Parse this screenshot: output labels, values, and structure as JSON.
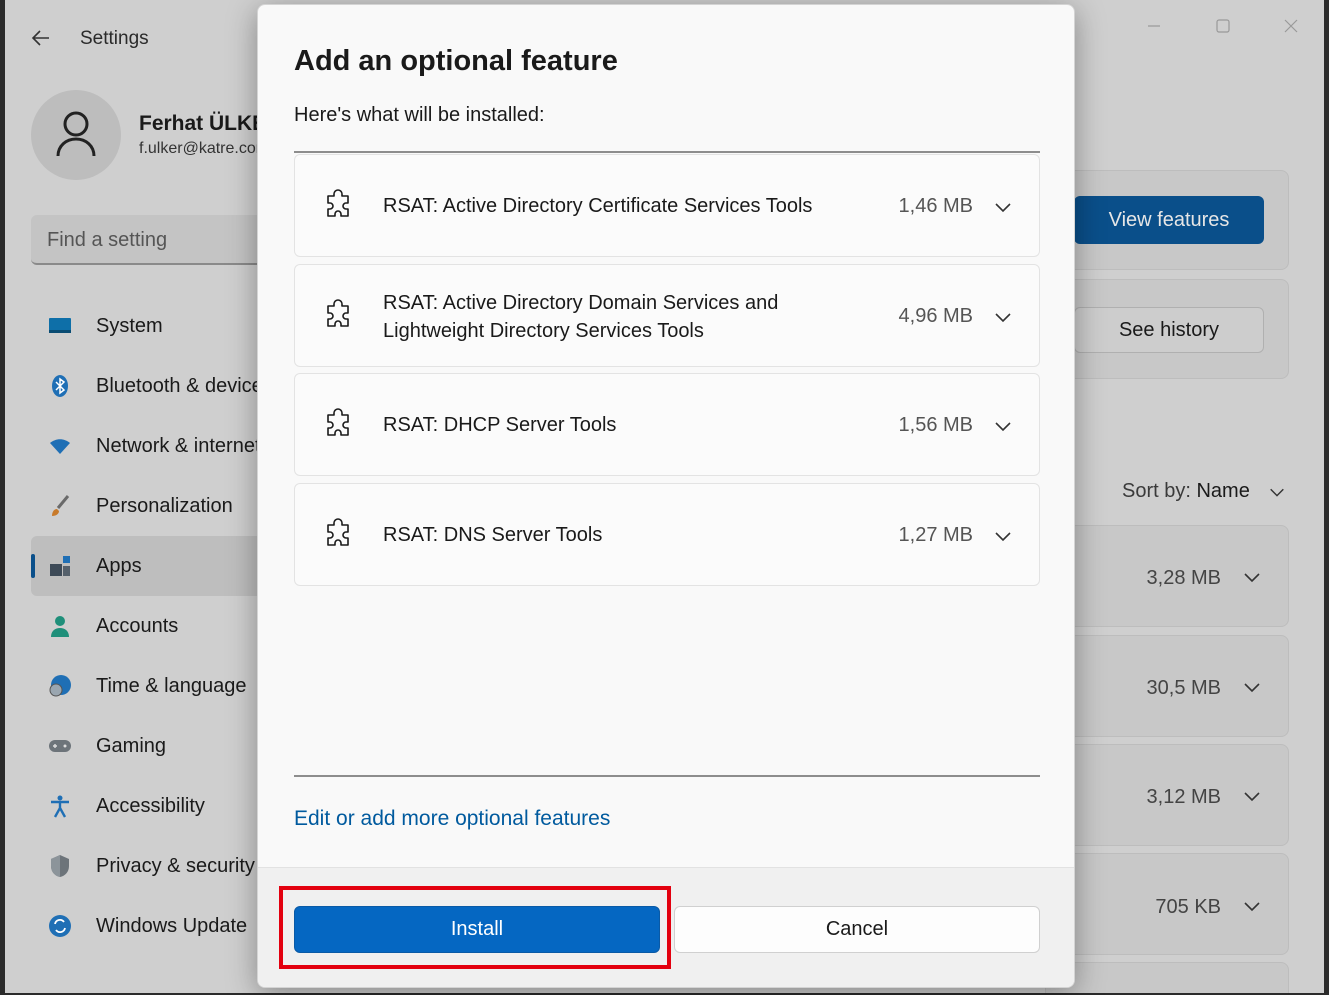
{
  "window": {
    "title": "Settings",
    "profile": {
      "name": "Ferhat ÜLKER",
      "email": "f.ulker@katre.com"
    },
    "search": {
      "placeholder": "Find a setting"
    },
    "nav": [
      {
        "label": "System",
        "icon": "monitor-icon",
        "active": false
      },
      {
        "label": "Bluetooth & devices",
        "icon": "bluetooth-icon",
        "active": false
      },
      {
        "label": "Network & internet",
        "icon": "wifi-icon",
        "active": false
      },
      {
        "label": "Personalization",
        "icon": "brush-icon",
        "active": false
      },
      {
        "label": "Apps",
        "icon": "apps-icon",
        "active": true
      },
      {
        "label": "Accounts",
        "icon": "person-icon",
        "active": false
      },
      {
        "label": "Time & language",
        "icon": "globe-clock-icon",
        "active": false
      },
      {
        "label": "Gaming",
        "icon": "gamepad-icon",
        "active": false
      },
      {
        "label": "Accessibility",
        "icon": "accessibility-icon",
        "active": false
      },
      {
        "label": "Privacy & security",
        "icon": "shield-icon",
        "active": false
      },
      {
        "label": "Windows Update",
        "icon": "update-icon",
        "active": false
      }
    ],
    "right": {
      "view_features_label": "View features",
      "see_history_label": "See history",
      "sort_label": "Sort by:",
      "sort_value": "Name",
      "installed_sizes": [
        "3,28 MB",
        "30,5 MB",
        "3,12 MB",
        "705 KB"
      ]
    }
  },
  "dialog": {
    "title": "Add an optional feature",
    "subtitle": "Here's what will be installed:",
    "features": [
      {
        "name": "RSAT: Active Directory Certificate Services Tools",
        "size": "1,46 MB"
      },
      {
        "name": "RSAT: Active Directory Domain Services and Lightweight Directory Services Tools",
        "size": "4,96 MB"
      },
      {
        "name": "RSAT: DHCP Server Tools",
        "size": "1,56 MB"
      },
      {
        "name": "RSAT: DNS Server Tools",
        "size": "1,27 MB"
      }
    ],
    "link_label": "Edit or add more optional features",
    "install_label": "Install",
    "cancel_label": "Cancel"
  },
  "colors": {
    "accent": "#0567c2",
    "highlight": "#e3000f",
    "link": "#005a9e"
  }
}
